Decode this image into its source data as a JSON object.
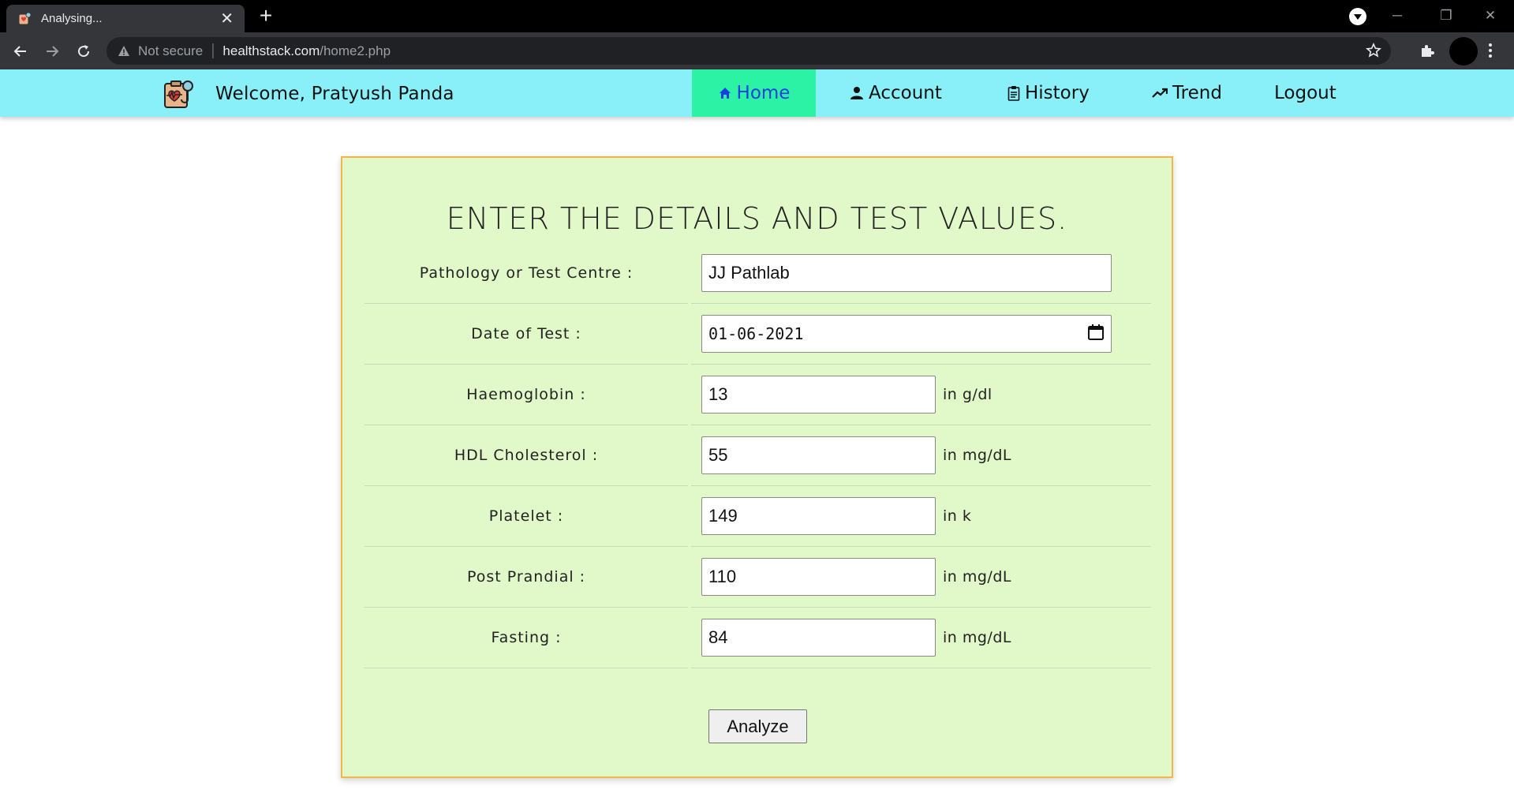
{
  "browser": {
    "tab_title": "Analysing...",
    "tab_close": "✕",
    "new_tab": "+",
    "security_label": "Not secure",
    "url_host": "healthstack.com",
    "url_path": "/home2.php",
    "window_controls": {
      "minimize": "─",
      "restore": "❐",
      "close": "✕"
    }
  },
  "navbar": {
    "welcome": "Welcome, Pratyush Panda",
    "items": [
      {
        "label": "Home",
        "icon": "home-icon",
        "active": true
      },
      {
        "label": "Account",
        "icon": "user-icon"
      },
      {
        "label": "History",
        "icon": "clipboard-icon"
      },
      {
        "label": "Trend",
        "icon": "trend-icon"
      },
      {
        "label": "Logout"
      }
    ]
  },
  "form": {
    "title": "ENTER THE DETAILS AND TEST VALUES.",
    "fields": [
      {
        "label": "Pathology or Test Centre :",
        "value": "JJ Pathlab",
        "unit": ""
      },
      {
        "label": "Date of Test :",
        "value": "01-06-2021",
        "unit": ""
      },
      {
        "label": "Haemoglobin :",
        "value": "13",
        "unit": "in g/dl"
      },
      {
        "label": "HDL Cholesterol :",
        "value": "55",
        "unit": "in mg/dL"
      },
      {
        "label": "Platelet :",
        "value": "149",
        "unit": "in k"
      },
      {
        "label": "Post Prandial :",
        "value": "110",
        "unit": "in mg/dL"
      },
      {
        "label": "Fasting :",
        "value": "84",
        "unit": "in mg/dL"
      }
    ],
    "submit_label": "Analyze"
  },
  "colors": {
    "navbar_bg": "#89f0fa",
    "nav_active_bg": "#2cf2a6",
    "nav_active_text": "#1a3fe0",
    "card_bg": "#e1f8c9",
    "card_border": "#f2b54a"
  }
}
